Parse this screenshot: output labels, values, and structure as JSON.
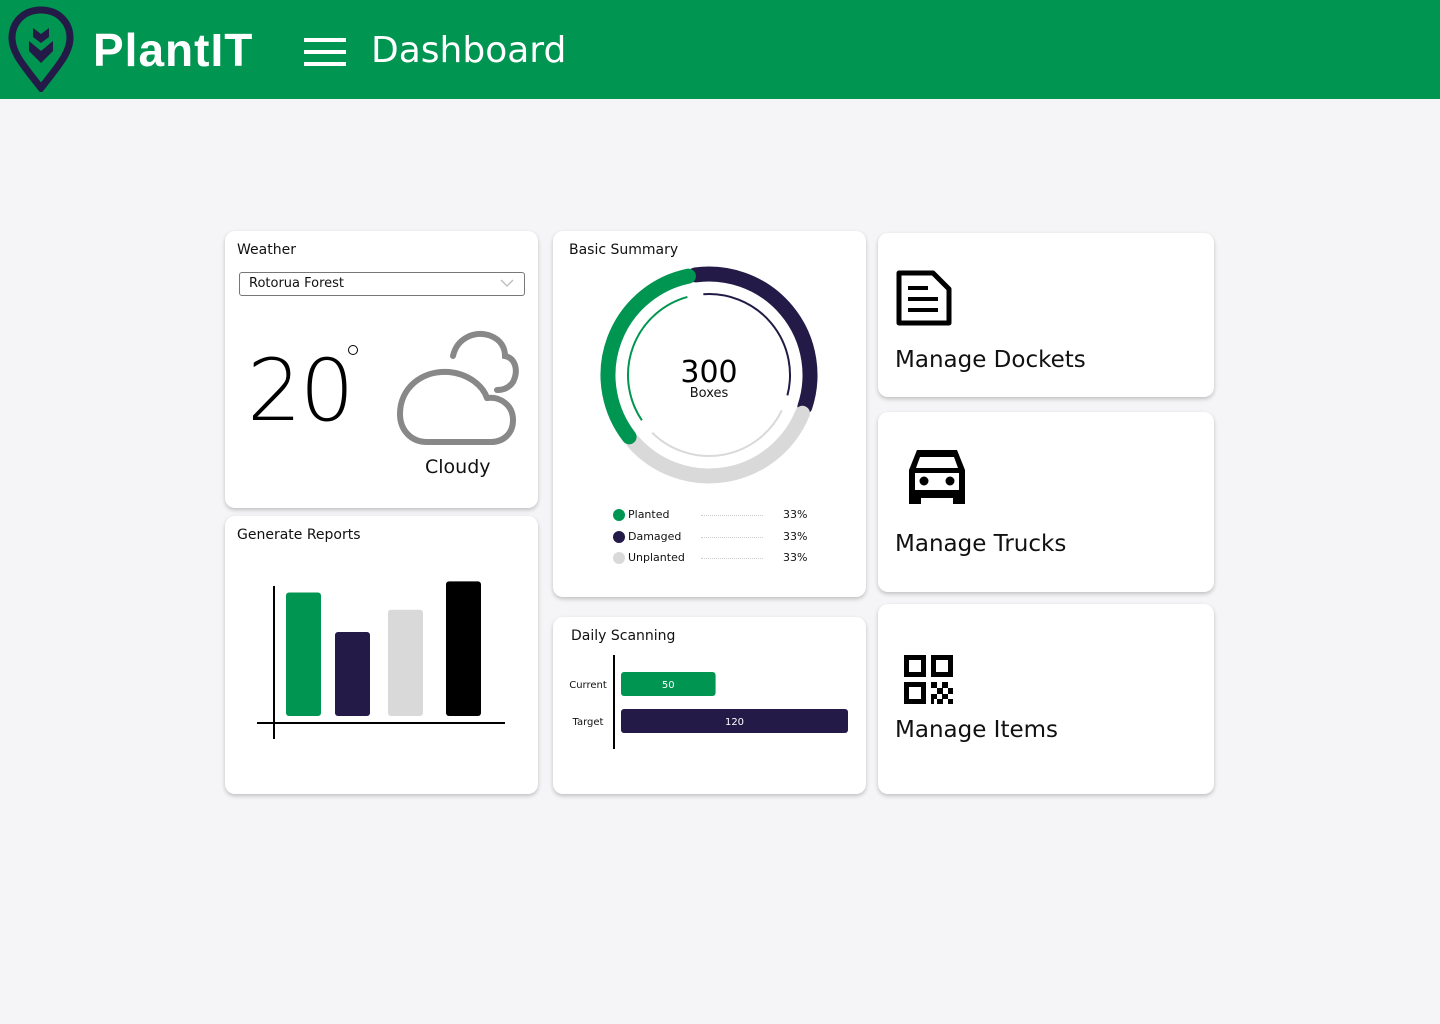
{
  "header": {
    "brand": "PlantIT",
    "page_title": "Dashboard",
    "logo_icon": "plant-pin-logo",
    "menu_icon": "hamburger-menu-icon",
    "colors": {
      "brand_green": "#009551",
      "navy": "#231a47",
      "gray": "#d9d9d9"
    }
  },
  "weather": {
    "title": "Weather",
    "location_select": {
      "value": "Rotorua Forest"
    },
    "temperature": "20",
    "temperature_unit_icon": "degree-symbol",
    "condition": "Cloudy",
    "condition_icon": "cloud-icon"
  },
  "reports": {
    "title": "Generate Reports",
    "chart_data": {
      "type": "bar",
      "title": "Generate Reports",
      "categories": [
        "",
        "",
        "",
        ""
      ],
      "values": [
        100,
        68,
        86,
        109
      ],
      "colors": [
        "#009551",
        "#231a47",
        "#d9d9d9",
        "#000000"
      ],
      "xlabel": "",
      "ylabel": "",
      "ylim": [
        0,
        115
      ],
      "grid": false,
      "note": "decorative icon-style chart, no tick labels; values are relative heights"
    }
  },
  "summary": {
    "title": "Basic Summary",
    "center_value": "300",
    "center_label": "Boxes",
    "chart_data": {
      "type": "pie",
      "title": "Basic Summary",
      "total": 300,
      "unit": "Boxes",
      "series": [
        {
          "name": "Planted",
          "value": 33,
          "label": "33%",
          "color": "#009551"
        },
        {
          "name": "Damaged",
          "value": 33,
          "label": "33%",
          "color": "#231a47"
        },
        {
          "name": "Unplanted",
          "value": 33,
          "label": "33%",
          "color": "#d9d9d9"
        }
      ],
      "legend": "bottom"
    }
  },
  "scanning": {
    "title": "Daily Scanning",
    "chart_data": {
      "type": "bar",
      "orientation": "horizontal",
      "title": "Daily Scanning",
      "categories": [
        "Current",
        "Target"
      ],
      "values": [
        50,
        120
      ],
      "labels": [
        "50",
        "120"
      ],
      "colors": [
        "#009551",
        "#231a47"
      ],
      "xlim": [
        0,
        120
      ]
    }
  },
  "actions": [
    {
      "label": "Manage Dockets",
      "icon": "document-icon"
    },
    {
      "label": "Manage Trucks",
      "icon": "car-icon"
    },
    {
      "label": "Manage Items",
      "icon": "qr-code-icon"
    }
  ]
}
